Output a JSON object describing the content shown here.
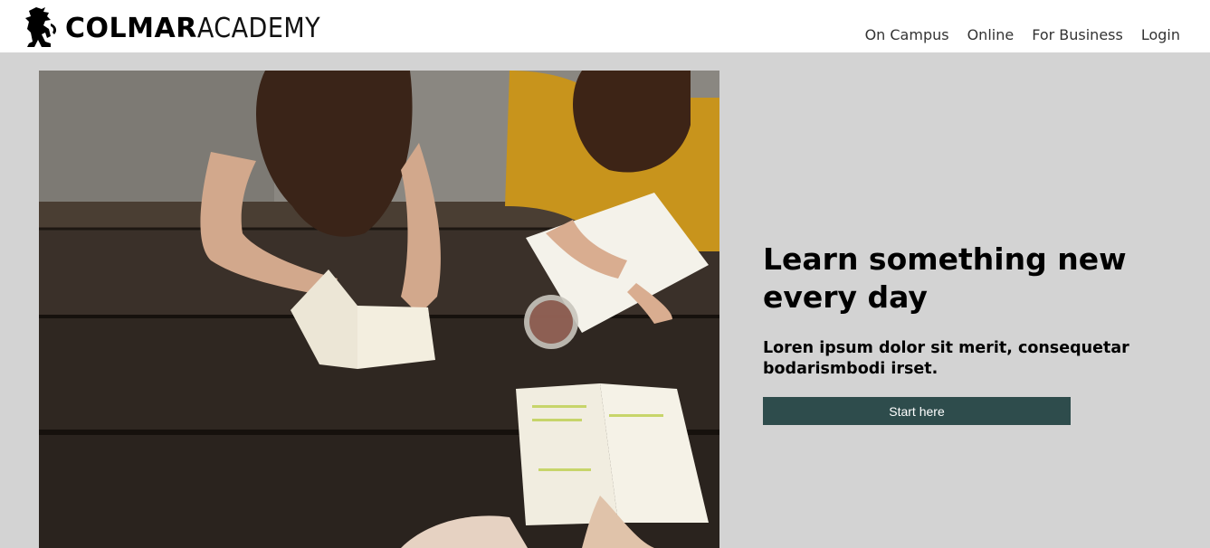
{
  "brand": {
    "name_bold": "COLMAR",
    "name_light": "ACADEMY",
    "logo_icon": "rearing-lion-icon"
  },
  "nav": {
    "items": [
      {
        "label": "On Campus"
      },
      {
        "label": "Online"
      },
      {
        "label": "For Business"
      },
      {
        "label": "Login"
      }
    ]
  },
  "hero": {
    "image_alt": "photo of people studying at a wooden table",
    "headline": "Learn something new every day",
    "subhead": "Loren ipsum dolor sit merit, consequetar bodarismbodi irset.",
    "cta_label": "Start here"
  },
  "colors": {
    "page_bg": "#d3d3d3",
    "header_bg": "#ffffff",
    "cta_bg": "#2e4c4c",
    "cta_text": "#ffffff"
  }
}
